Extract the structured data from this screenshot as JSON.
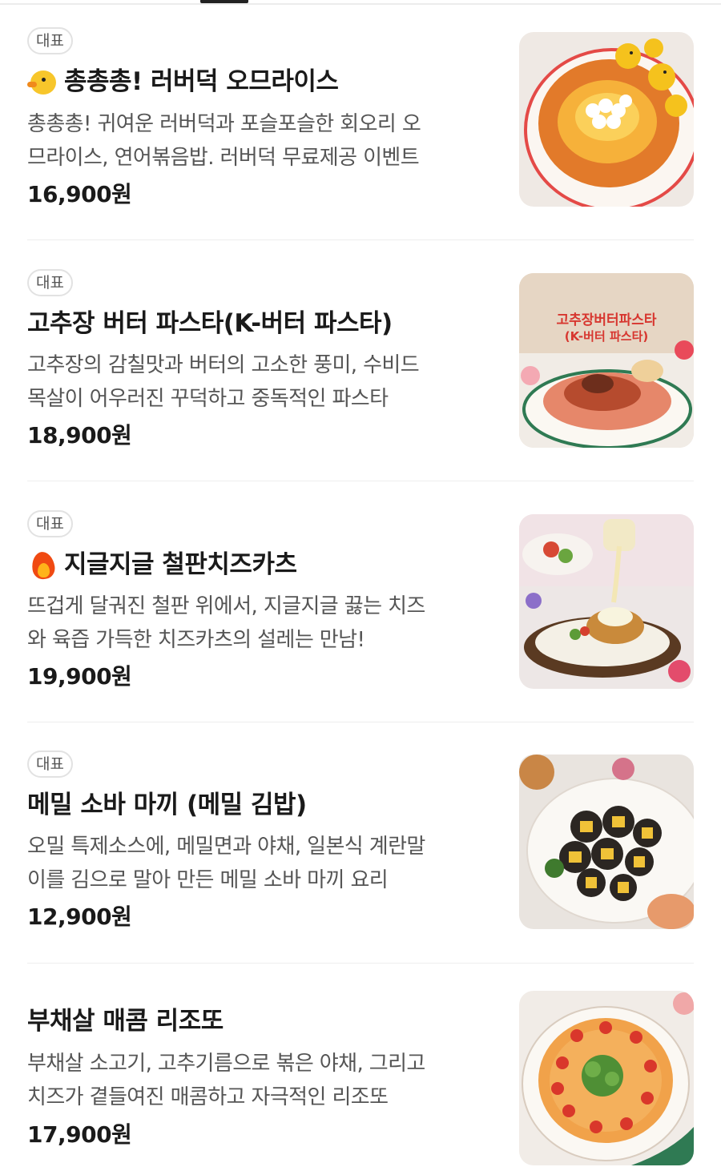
{
  "menu": {
    "items": [
      {
        "badge": "대표",
        "emoji": "duck-emoji",
        "title": "총총총! 러버덕 오므라이스",
        "desc_lines": [
          "총총총! 귀여운 러버덕과 포슬포슬한 회오리 오",
          "므라이스, 연어볶음밥. 러버덕 무료제공 이벤트"
        ],
        "price": "16,900원",
        "image": "omurice-rubber-duck-photo"
      },
      {
        "badge": "대표",
        "title": "고추장 버터 파스타(K-버터 파스타)",
        "desc_lines": [
          "고추장의 감칠맛과 버터의 고소한 풍미, 수비드",
          "목살이 어우러진 꾸덕하고 중독적인 파스타"
        ],
        "price": "18,900원",
        "image": "gochujang-butter-pasta-photo",
        "image_text": [
          "고추장버터파스타",
          "(K-버터 파스타)"
        ]
      },
      {
        "badge": "대표",
        "emoji": "fire-emoji",
        "title": "지글지글 철판치즈카츠",
        "desc_lines": [
          "뜨겁게 달궈진 철판 위에서, 지글지글 끓는 치즈",
          "와 육즙 가득한 치즈카츠의 설레는 만남!"
        ],
        "price": "19,900원",
        "image": "cheese-katsu-photo"
      },
      {
        "badge": "대표",
        "title": "메밀 소바 마끼 (메밀 김밥)",
        "desc_lines": [
          "오밀 특제소스에, 메밀면과 야채, 일본식 계란말",
          "이를 김으로 말아 만든 메밀 소바 마끼 요리"
        ],
        "price": "12,900원",
        "image": "soba-maki-photo"
      },
      {
        "title": "부채살 매콤 리조또",
        "desc_lines": [
          "부채살 소고기, 고추기름으로 볶은 야채, 그리고",
          "치즈가 곁들여진 매콤하고 자극적인 리조또"
        ],
        "price": "17,900원",
        "image": "spicy-risotto-photo"
      }
    ]
  },
  "colors": {
    "divider": "#eeeeee",
    "badge_border": "#e2e2e2",
    "text_primary": "#1a1a1a",
    "text_secondary": "#555555"
  }
}
